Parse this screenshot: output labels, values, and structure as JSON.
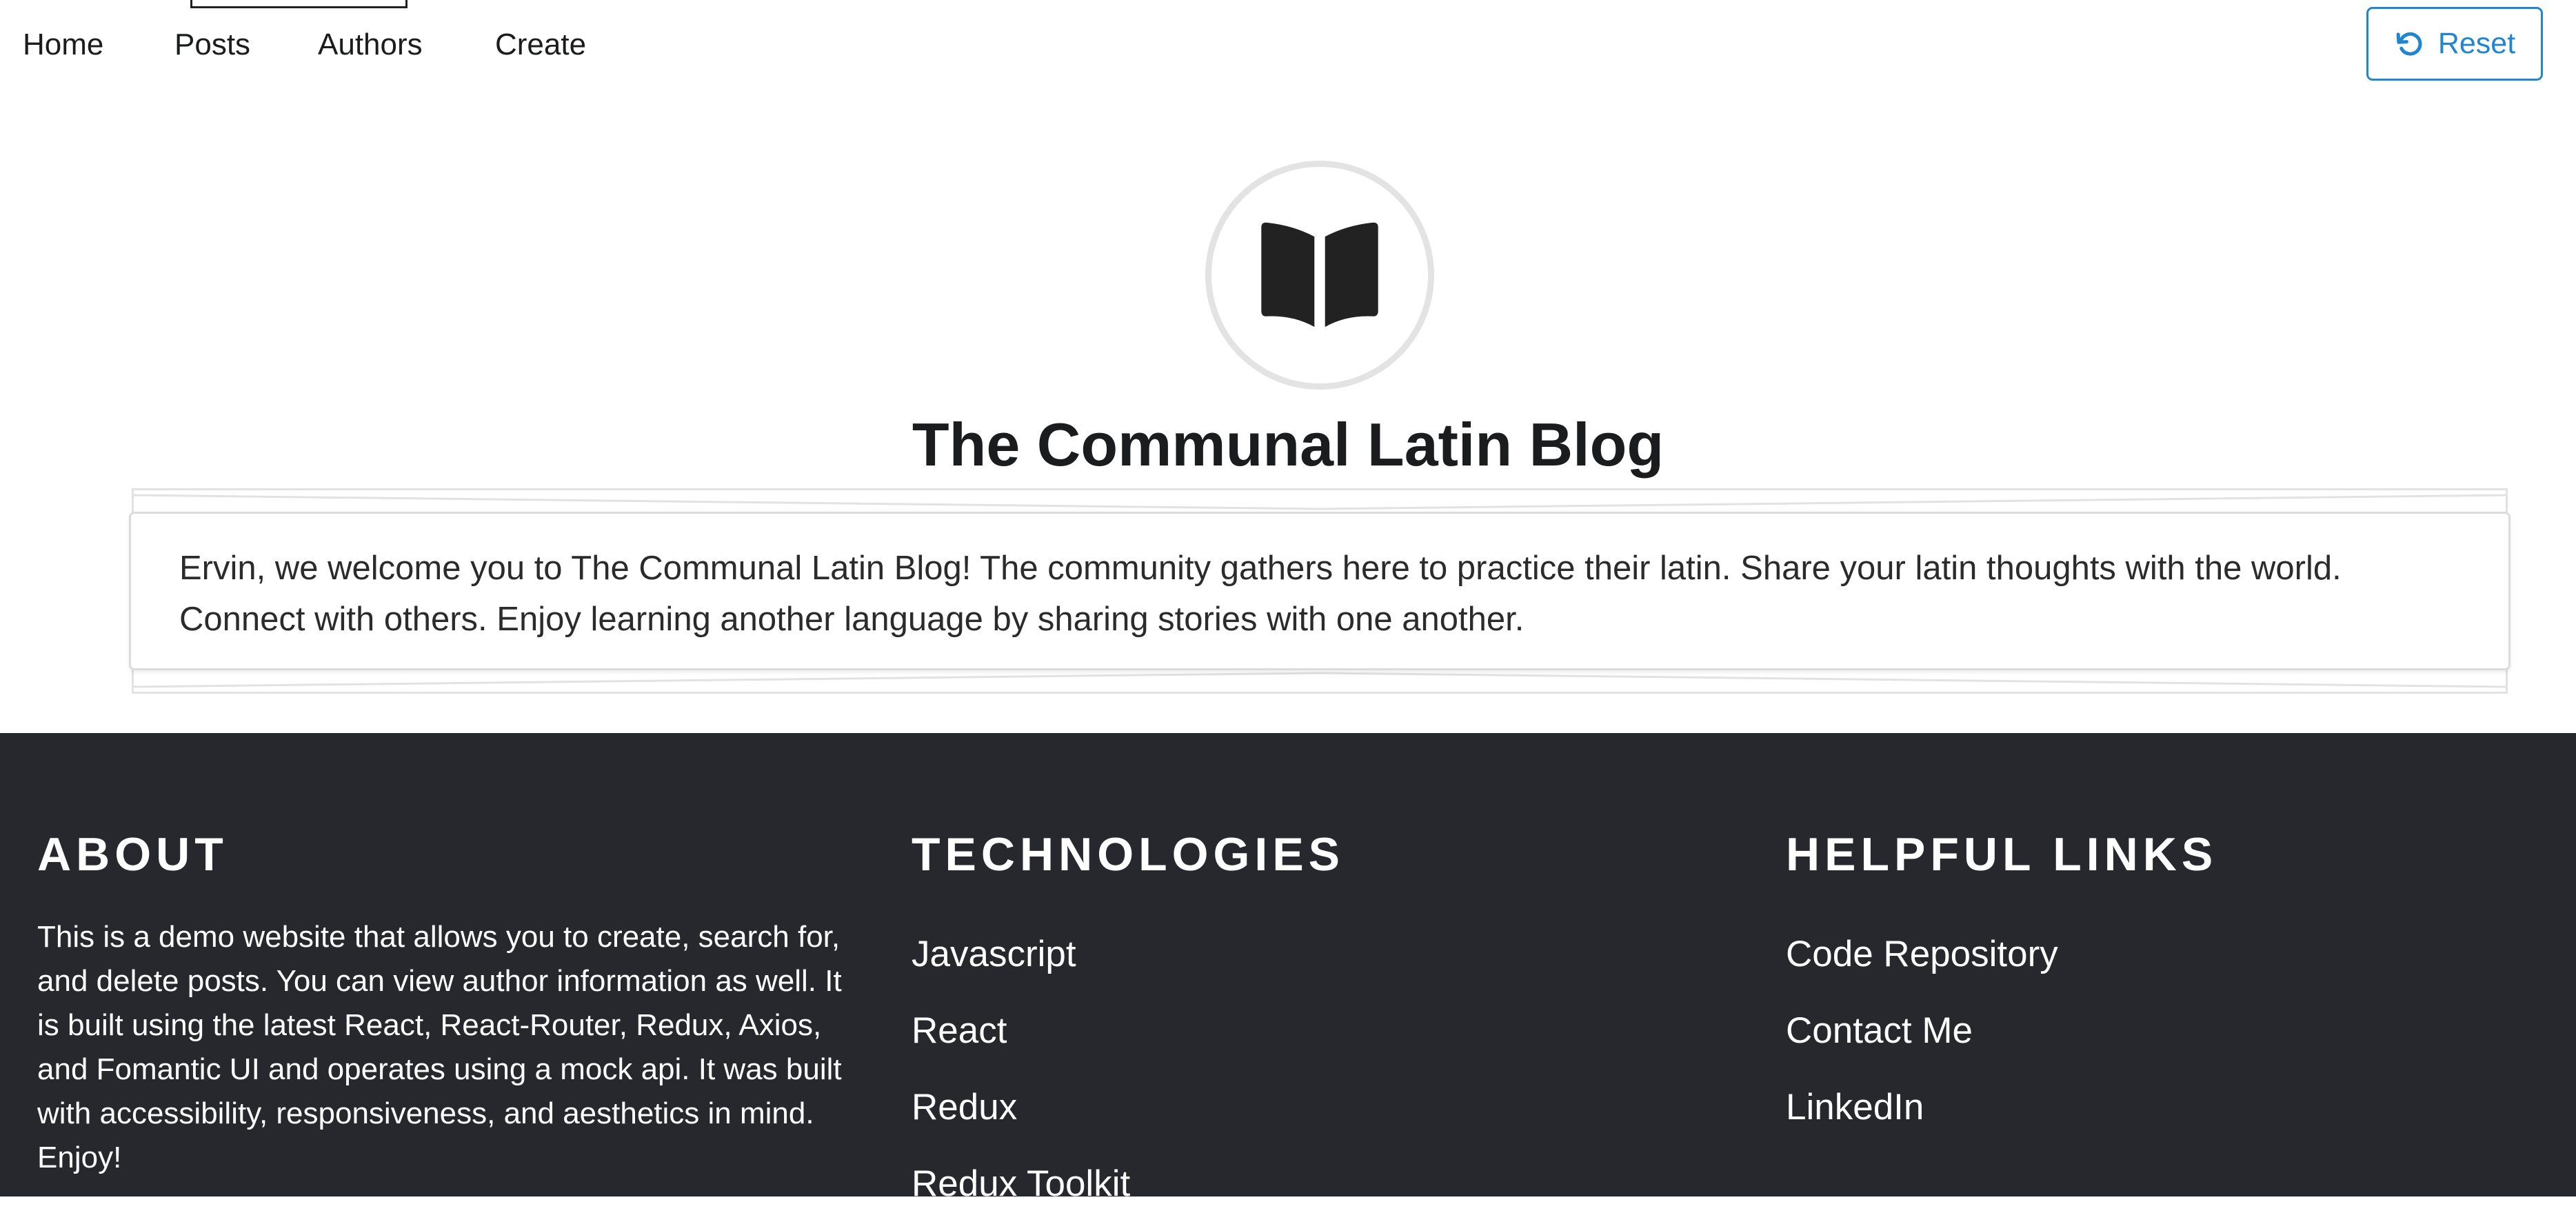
{
  "nav": {
    "items": [
      {
        "label": "Home"
      },
      {
        "label": "Posts"
      },
      {
        "label": "Authors"
      },
      {
        "label": "Create"
      }
    ],
    "active_index": 1,
    "reset_label": "Reset",
    "reset_icon": "undo-icon",
    "accent_color": "#2185d0"
  },
  "hero": {
    "icon": "book-open-icon",
    "title": "The Communal Latin Blog",
    "welcome_text": "Ervin, we welcome you to The Communal Latin Blog! The community gathers here to practice their latin. Share your latin thoughts with the world. Connect with others. Enjoy learning another language by sharing stories with one another."
  },
  "footer": {
    "background_color": "#27282d",
    "about": {
      "heading": "ABOUT",
      "text": "This is a demo website that allows you to create, search for, and delete posts. You can view author information as well. It is built using the latest React, React-Router, Redux, Axios, and Fomantic UI and operates using a mock api. It was built with accessibility, responsiveness, and aesthetics in mind. Enjoy!"
    },
    "technologies": {
      "heading": "TECHNOLOGIES",
      "items": [
        {
          "label": "Javascript"
        },
        {
          "label": "React"
        },
        {
          "label": "Redux"
        },
        {
          "label": "Redux Toolkit"
        }
      ]
    },
    "helpful_links": {
      "heading": "HELPFUL LINKS",
      "items": [
        {
          "label": "Code Repository"
        },
        {
          "label": "Contact Me"
        },
        {
          "label": "LinkedIn"
        }
      ]
    }
  }
}
